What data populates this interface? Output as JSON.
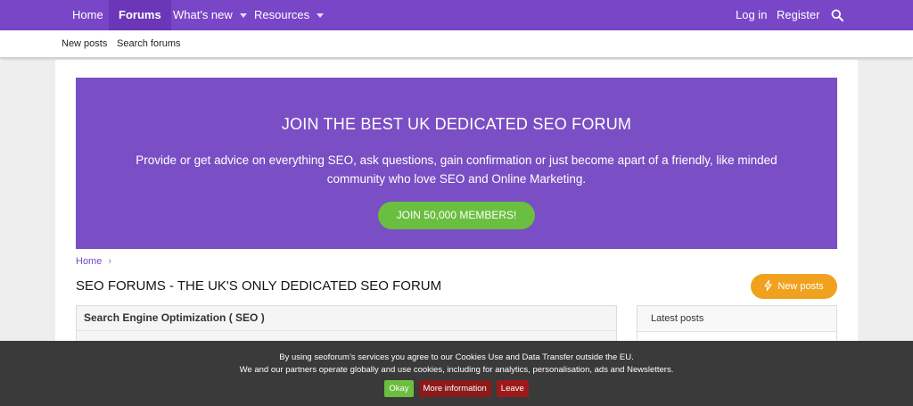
{
  "topnav": {
    "items": [
      {
        "label": "Home",
        "active": false,
        "dropdown": false
      },
      {
        "label": "Forums",
        "active": true,
        "dropdown": false
      },
      {
        "label": "What's new",
        "active": false,
        "dropdown": true
      },
      {
        "label": "Resources",
        "active": false,
        "dropdown": true
      }
    ],
    "login": "Log in",
    "register": "Register",
    "search_icon": "search-icon"
  },
  "subnav": {
    "items": [
      "New posts",
      "Search forums"
    ]
  },
  "banner": {
    "title": "JOIN THE BEST UK DEDICATED SEO FORUM",
    "text": "Provide or get advice on everything SEO, ask questions, gain confirmation or just become apart of a friendly, like minded community who love SEO and Online Marketing.",
    "button": "JOIN 50,000 MEMBERS!"
  },
  "breadcrumb": {
    "home": "Home",
    "separator": "›"
  },
  "page_title": "SEO FORUMS - THE UK'S ONLY DEDICATED SEO FORUM",
  "new_posts_button": {
    "label": "New posts",
    "icon": "bolt-icon"
  },
  "forum_block": {
    "title": "Search Engine Optimization ( SEO )"
  },
  "sidebar": {
    "latest_posts_title": "Latest posts"
  },
  "cookie": {
    "line1": "By using seoforum’s services you agree to our Cookies Use and Data Transfer outside the EU.",
    "line2": "We and our partners operate globally and use cookies, including for analytics, personalisation, ads and Newsletters.",
    "ok": "Okay",
    "more": "More information",
    "leave": "Leave"
  },
  "colors": {
    "brand_purple": "#7a46c8",
    "banner_purple": "#7a4ec4",
    "join_green": "#6abf40",
    "new_posts_orange": "#f0a21f",
    "cookie_bg": "#3a3a3a",
    "leave_red": "#9e1a1a"
  }
}
